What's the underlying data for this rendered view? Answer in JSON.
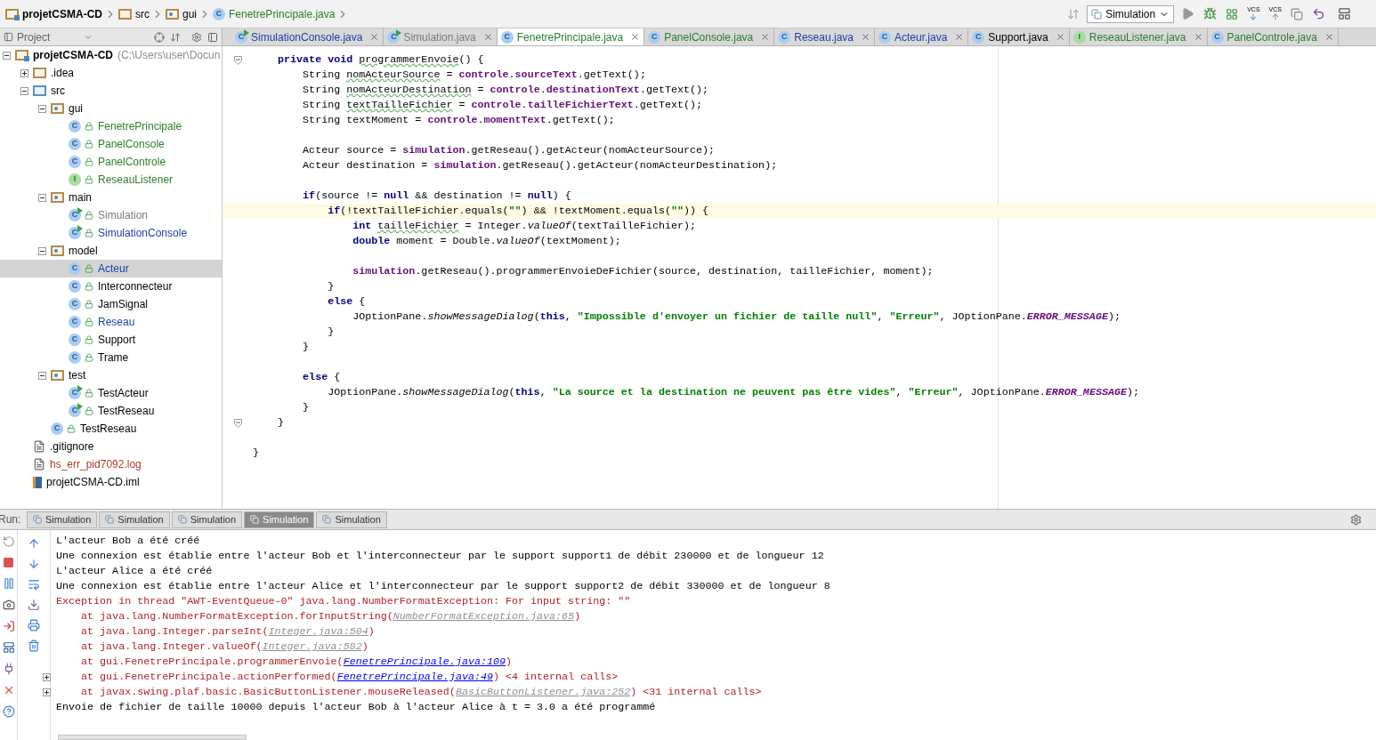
{
  "breadcrumb": [
    {
      "label": "projetCSMA-CD",
      "kind": "module"
    },
    {
      "label": "src",
      "kind": "folder"
    },
    {
      "label": "gui",
      "kind": "package"
    },
    {
      "label": "FenetrePrincipale.java",
      "kind": "class",
      "badge": "C"
    }
  ],
  "toolbar": {
    "run_config": "Simulation",
    "vcs_labels": [
      "VCS",
      "VCS"
    ]
  },
  "project_panel": {
    "title": "Project"
  },
  "editor_tabs": [
    {
      "label": "SimulationConsole.java",
      "kind": "runnable",
      "badge": "C",
      "color": "#1c3fa8",
      "selected": false
    },
    {
      "label": "Simulation.java",
      "kind": "runnable",
      "badge": "C",
      "color": "#7a7a7a",
      "selected": false
    },
    {
      "label": "FenetrePrincipale.java",
      "kind": "class",
      "badge": "C",
      "color": "#2c7d2c",
      "selected": true
    },
    {
      "label": "PanelConsole.java",
      "kind": "class",
      "badge": "C",
      "color": "#2c7d2c",
      "selected": false
    },
    {
      "label": "Reseau.java",
      "kind": "class",
      "badge": "C",
      "color": "#1c3fa8",
      "selected": false
    },
    {
      "label": "Acteur.java",
      "kind": "class",
      "badge": "C",
      "color": "#1c3fa8",
      "selected": false
    },
    {
      "label": "Support.java",
      "kind": "class",
      "badge": "C",
      "color": "#000000",
      "selected": false
    },
    {
      "label": "ReseauListener.java",
      "kind": "interface",
      "badge": "I",
      "color": "#2c7d2c",
      "selected": false
    },
    {
      "label": "PanelControle.java",
      "kind": "class",
      "badge": "C",
      "color": "#2c7d2c",
      "selected": false
    }
  ],
  "tree": {
    "items": [
      {
        "label": "projetCSMA-CD",
        "suffix": "(C:\\Users\\user\\Docun",
        "kind": "module",
        "selected": false,
        "expanded": true,
        "children": [
          {
            "label": ".idea",
            "kind": "folder",
            "selected": false,
            "expanded": false
          },
          {
            "label": "src",
            "kind": "src",
            "selected": false,
            "expanded": true,
            "children": [
              {
                "label": "gui",
                "kind": "package",
                "selected": false,
                "expanded": true,
                "children": [
                  {
                    "label": "FenetrePrincipale",
                    "kind": "class",
                    "badge": "C",
                    "color": "#2c7d2c",
                    "selected": false
                  },
                  {
                    "label": "PanelConsole",
                    "kind": "class",
                    "badge": "C",
                    "color": "#2c7d2c",
                    "selected": false
                  },
                  {
                    "label": "PanelControle",
                    "kind": "class",
                    "badge": "C",
                    "color": "#2c7d2c",
                    "selected": false
                  },
                  {
                    "label": "ReseauListener",
                    "kind": "interface",
                    "badge": "I",
                    "color": "#2c7d2c",
                    "selected": false
                  }
                ]
              },
              {
                "label": "main",
                "kind": "package",
                "selected": false,
                "expanded": true,
                "children": [
                  {
                    "label": "Simulation",
                    "kind": "runnable",
                    "badge": "C",
                    "color": "#7a7a7a",
                    "selected": false
                  },
                  {
                    "label": "SimulationConsole",
                    "kind": "runnable",
                    "badge": "C",
                    "color": "#1c3fa8",
                    "selected": false
                  }
                ]
              },
              {
                "label": "model",
                "kind": "package",
                "selected": false,
                "expanded": true,
                "children": [
                  {
                    "label": "Acteur",
                    "kind": "class",
                    "badge": "C",
                    "color": "#1c3fa8",
                    "selected": true
                  },
                  {
                    "label": "Interconnecteur",
                    "kind": "class",
                    "badge": "C",
                    "color": "#000000",
                    "selected": false
                  },
                  {
                    "label": "JamSignal",
                    "kind": "class",
                    "badge": "C",
                    "color": "#000000",
                    "selected": false
                  },
                  {
                    "label": "Reseau",
                    "kind": "class",
                    "badge": "C",
                    "color": "#1c3fa8",
                    "selected": false
                  },
                  {
                    "label": "Support",
                    "kind": "class",
                    "badge": "C",
                    "color": "#000000",
                    "selected": false
                  },
                  {
                    "label": "Trame",
                    "kind": "class",
                    "badge": "C",
                    "color": "#000000",
                    "selected": false
                  }
                ]
              },
              {
                "label": "test",
                "kind": "package",
                "selected": false,
                "expanded": true,
                "children": [
                  {
                    "label": "TestActeur",
                    "kind": "runnable",
                    "badge": "C",
                    "color": "#000000",
                    "selected": false
                  },
                  {
                    "label": "TestReseau",
                    "kind": "runnable",
                    "badge": "C",
                    "color": "#000000",
                    "selected": false
                  }
                ]
              },
              {
                "label": "TestReseau",
                "kind": "class",
                "badge": "C",
                "color": "#000000",
                "selected": false
              }
            ]
          },
          {
            "label": ".gitignore",
            "kind": "file",
            "color": "#000000",
            "selected": false
          },
          {
            "label": "hs_err_pid7092.log",
            "kind": "file",
            "color": "#b03a2e",
            "selected": false
          },
          {
            "label": "projetCSMA-CD.iml",
            "kind": "iml",
            "color": "#000000",
            "selected": false
          }
        ]
      }
    ]
  },
  "code_lines": [
    {
      "current": false,
      "fold": true,
      "segments": [
        {
          "kind": "kw",
          "text": "    private void "
        },
        {
          "kind": "warn",
          "text": "programmerEnvoie"
        },
        {
          "kind": "plain",
          "text": "() {"
        }
      ]
    },
    {
      "current": false,
      "fold": false,
      "segments": [
        {
          "kind": "plain",
          "text": "        String "
        },
        {
          "kind": "warn",
          "text": "nomActeurSource"
        },
        {
          "kind": "plain",
          "text": " = "
        },
        {
          "kind": "field",
          "text": "controle"
        },
        {
          "kind": "plain",
          "text": "."
        },
        {
          "kind": "field",
          "text": "sourceText"
        },
        {
          "kind": "plain",
          "text": ".getText();"
        }
      ]
    },
    {
      "current": false,
      "fold": false,
      "segments": [
        {
          "kind": "plain",
          "text": "        String "
        },
        {
          "kind": "warn",
          "text": "nomActeurDestination"
        },
        {
          "kind": "plain",
          "text": " = "
        },
        {
          "kind": "field",
          "text": "controle"
        },
        {
          "kind": "plain",
          "text": "."
        },
        {
          "kind": "field",
          "text": "destinationText"
        },
        {
          "kind": "plain",
          "text": ".getText();"
        }
      ]
    },
    {
      "current": false,
      "fold": false,
      "segments": [
        {
          "kind": "plain",
          "text": "        String "
        },
        {
          "kind": "warn",
          "text": "textTailleFichier"
        },
        {
          "kind": "plain",
          "text": " = "
        },
        {
          "kind": "field",
          "text": "controle"
        },
        {
          "kind": "plain",
          "text": "."
        },
        {
          "kind": "field",
          "text": "tailleFichierText"
        },
        {
          "kind": "plain",
          "text": ".getText();"
        }
      ]
    },
    {
      "current": false,
      "fold": false,
      "segments": [
        {
          "kind": "plain",
          "text": "        String textMoment = "
        },
        {
          "kind": "field",
          "text": "controle"
        },
        {
          "kind": "plain",
          "text": "."
        },
        {
          "kind": "field",
          "text": "momentText"
        },
        {
          "kind": "plain",
          "text": ".getText();"
        }
      ]
    },
    {
      "current": false,
      "fold": false
    },
    {
      "current": false,
      "fold": false,
      "segments": [
        {
          "kind": "plain",
          "text": "        Acteur source = "
        },
        {
          "kind": "field",
          "text": "simulation"
        },
        {
          "kind": "plain",
          "text": ".getReseau().getActeur(nomActeurSource);"
        }
      ]
    },
    {
      "current": false,
      "fold": false,
      "segments": [
        {
          "kind": "plain",
          "text": "        Acteur destination = "
        },
        {
          "kind": "field",
          "text": "simulation"
        },
        {
          "kind": "plain",
          "text": ".getReseau().getActeur(nomActeurDestination);"
        }
      ]
    },
    {
      "current": false,
      "fold": false
    },
    {
      "current": false,
      "fold": false,
      "segments": [
        {
          "kind": "kw",
          "text": "        if"
        },
        {
          "kind": "plain",
          "text": "(source != "
        },
        {
          "kind": "kw",
          "text": "null"
        },
        {
          "kind": "plain",
          "text": " && destination != "
        },
        {
          "kind": "kw",
          "text": "null"
        },
        {
          "kind": "plain",
          "text": ") {"
        }
      ]
    },
    {
      "current": true,
      "fold": false,
      "segments": [
        {
          "kind": "kw",
          "text": "            if"
        },
        {
          "kind": "plain",
          "text": "(!textTailleFichier.equals("
        },
        {
          "kind": "str",
          "text": "\"\""
        },
        {
          "kind": "plain",
          "text": ") && !textMoment.equals("
        },
        {
          "kind": "str",
          "text": "\"\""
        },
        {
          "kind": "plain",
          "text": ")) {"
        }
      ]
    },
    {
      "current": false,
      "fold": false,
      "segments": [
        {
          "kind": "kw",
          "text": "                int "
        },
        {
          "kind": "warn",
          "text": "tailleFichier"
        },
        {
          "kind": "plain",
          "text": " = Integer."
        },
        {
          "kind": "static",
          "text": "valueOf"
        },
        {
          "kind": "plain",
          "text": "(textTailleFichier);"
        }
      ]
    },
    {
      "current": false,
      "fold": false,
      "segments": [
        {
          "kind": "kw",
          "text": "                double"
        },
        {
          "kind": "plain",
          "text": " moment = Double."
        },
        {
          "kind": "static",
          "text": "valueOf"
        },
        {
          "kind": "plain",
          "text": "(textMoment);"
        }
      ]
    },
    {
      "current": false,
      "fold": false
    },
    {
      "current": false,
      "fold": false,
      "segments": [
        {
          "kind": "field",
          "text": "                simulation"
        },
        {
          "kind": "plain",
          "text": ".getReseau().programmerEnvoieDeFichier(source, destination, tailleFichier, moment);"
        }
      ]
    },
    {
      "current": false,
      "fold": false,
      "segments": [
        {
          "kind": "plain",
          "text": "            }"
        }
      ]
    },
    {
      "current": false,
      "fold": false,
      "segments": [
        {
          "kind": "kw",
          "text": "            else"
        },
        {
          "kind": "plain",
          "text": " {"
        }
      ]
    },
    {
      "current": false,
      "fold": false,
      "segments": [
        {
          "kind": "plain",
          "text": "                JOptionPane."
        },
        {
          "kind": "static",
          "text": "showMessageDialog"
        },
        {
          "kind": "plain",
          "text": "("
        },
        {
          "kind": "kw",
          "text": "this"
        },
        {
          "kind": "plain",
          "text": ", "
        },
        {
          "kind": "str",
          "text": "\"Impossible d'envoyer un fichier de taille null\""
        },
        {
          "kind": "plain",
          "text": ", "
        },
        {
          "kind": "str",
          "text": "\"Erreur\""
        },
        {
          "kind": "plain",
          "text": ", JOptionPane."
        },
        {
          "kind": "const",
          "text": "ERROR_MESSAGE"
        },
        {
          "kind": "plain",
          "text": ");"
        }
      ]
    },
    {
      "current": false,
      "fold": false,
      "segments": [
        {
          "kind": "plain",
          "text": "            }"
        }
      ]
    },
    {
      "current": false,
      "fold": false,
      "segments": [
        {
          "kind": "plain",
          "text": "        }"
        }
      ]
    },
    {
      "current": false,
      "fold": false
    },
    {
      "current": false,
      "fold": false,
      "segments": [
        {
          "kind": "kw",
          "text": "        else"
        },
        {
          "kind": "plain",
          "text": " {"
        }
      ]
    },
    {
      "current": false,
      "fold": false,
      "segments": [
        {
          "kind": "plain",
          "text": "            JOptionPane."
        },
        {
          "kind": "static",
          "text": "showMessageDialog"
        },
        {
          "kind": "plain",
          "text": "("
        },
        {
          "kind": "kw",
          "text": "this"
        },
        {
          "kind": "plain",
          "text": ", "
        },
        {
          "kind": "str",
          "text": "\"La source et la destination ne peuvent pas être vides\""
        },
        {
          "kind": "plain",
          "text": ", "
        },
        {
          "kind": "str",
          "text": "\"Erreur\""
        },
        {
          "kind": "plain",
          "text": ", JOptionPane."
        },
        {
          "kind": "const",
          "text": "ERROR_MESSAGE"
        },
        {
          "kind": "plain",
          "text": ");"
        }
      ]
    },
    {
      "current": false,
      "fold": false,
      "segments": [
        {
          "kind": "plain",
          "text": "        }"
        }
      ]
    },
    {
      "current": false,
      "fold": true,
      "segments": [
        {
          "kind": "plain",
          "text": "    }"
        }
      ]
    },
    {
      "current": false,
      "fold": false
    },
    {
      "current": false,
      "fold": false,
      "segments": [
        {
          "kind": "plain",
          "text": "}"
        }
      ]
    }
  ],
  "run_panel": {
    "label": "Run:",
    "tabs": [
      {
        "label": "Simulation",
        "selected": false
      },
      {
        "label": "Simulation",
        "selected": false
      },
      {
        "label": "Simulation",
        "selected": false
      },
      {
        "label": "Simulation",
        "selected": true
      },
      {
        "label": "Simulation",
        "selected": false
      }
    ]
  },
  "console_lines": [
    {
      "kind": "out",
      "foldable": false,
      "segments": [
        {
          "kind": "text",
          "text": "L'acteur Bob a été créé"
        }
      ]
    },
    {
      "kind": "out",
      "foldable": false,
      "segments": [
        {
          "kind": "text",
          "text": "Une connexion est établie entre l'acteur Bob et l'interconnecteur par le support support1 de débit 230000 et de longueur 12"
        }
      ]
    },
    {
      "kind": "out",
      "foldable": false,
      "segments": [
        {
          "kind": "text",
          "text": "L'acteur Alice a été créé"
        }
      ]
    },
    {
      "kind": "out",
      "foldable": false,
      "segments": [
        {
          "kind": "text",
          "text": "Une connexion est établie entre l'acteur Alice et l'interconnecteur par le support support2 de débit 330000 et de longueur 8"
        }
      ]
    },
    {
      "kind": "err",
      "foldable": false,
      "segments": [
        {
          "kind": "text",
          "text": "Exception in thread \"AWT-EventQueue-0\" java.lang.NumberFormatException: For input string: \"\""
        }
      ]
    },
    {
      "kind": "err",
      "foldable": false,
      "segments": [
        {
          "kind": "text",
          "text": "    at java.lang.NumberFormatException.forInputString("
        },
        {
          "kind": "lib_link",
          "text": "NumberFormatException.java:65"
        },
        {
          "kind": "text",
          "text": ")"
        }
      ]
    },
    {
      "kind": "err",
      "foldable": false,
      "segments": [
        {
          "kind": "text",
          "text": "    at java.lang.Integer.parseInt("
        },
        {
          "kind": "lib_link",
          "text": "Integer.java:504"
        },
        {
          "kind": "text",
          "text": ")"
        }
      ]
    },
    {
      "kind": "err",
      "foldable": false,
      "segments": [
        {
          "kind": "text",
          "text": "    at java.lang.Integer.valueOf("
        },
        {
          "kind": "lib_link",
          "text": "Integer.java:582"
        },
        {
          "kind": "text",
          "text": ")"
        }
      ]
    },
    {
      "kind": "err",
      "foldable": false,
      "segments": [
        {
          "kind": "text",
          "text": "    at gui.FenetrePrincipale.programmerEnvoie("
        },
        {
          "kind": "link",
          "text": "FenetrePrincipale.java:109"
        },
        {
          "kind": "text",
          "text": ")"
        }
      ]
    },
    {
      "kind": "err",
      "foldable": true,
      "segments": [
        {
          "kind": "text",
          "text": "    at gui.FenetrePrincipale.actionPerformed("
        },
        {
          "kind": "link",
          "text": "FenetrePrincipale.java:49"
        },
        {
          "kind": "text",
          "text": ")"
        },
        {
          "kind": "note",
          "text": " <4 internal calls>"
        }
      ]
    },
    {
      "kind": "err",
      "foldable": true,
      "segments": [
        {
          "kind": "text",
          "text": "    at javax.swing.plaf.basic.BasicButtonListener.mouseReleased("
        },
        {
          "kind": "lib_link",
          "text": "BasicButtonListener.java:252"
        },
        {
          "kind": "text",
          "text": ")"
        },
        {
          "kind": "note",
          "text": " <31 internal calls>"
        }
      ]
    },
    {
      "kind": "out",
      "foldable": false,
      "segments": [
        {
          "kind": "text",
          "text": "Envoie de fichier de taille 10000 depuis l'acteur Bob à l'acteur Alice à t = 3.0 a été programmé"
        }
      ]
    }
  ]
}
